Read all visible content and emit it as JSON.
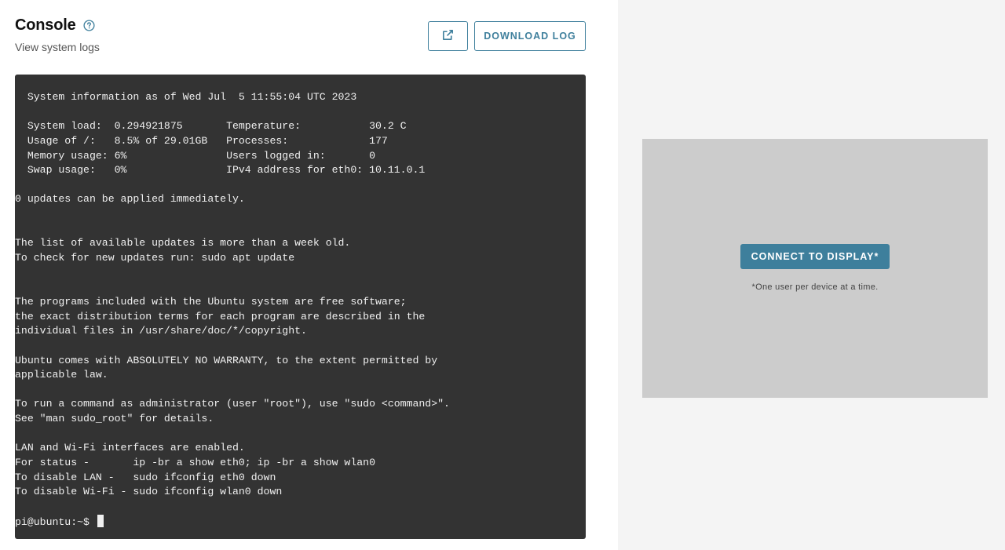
{
  "header": {
    "title": "Console",
    "subtitle": "View system logs",
    "help_icon": "question-circle-icon",
    "external_icon": "external-link-icon",
    "download_label": "DOWNLOAD LOG"
  },
  "colors": {
    "accent": "#3e7f9c",
    "terminal_bg": "#333333",
    "terminal_fg": "#f0f0f0",
    "right_pane_bg": "#f4f4f4",
    "display_bg": "#cccccc"
  },
  "terminal": {
    "lines": [
      "  System information as of Wed Jul  5 11:55:04 UTC 2023",
      "",
      "  System load:  0.294921875       Temperature:           30.2 C",
      "  Usage of /:   8.5% of 29.01GB   Processes:             177",
      "  Memory usage: 6%                Users logged in:       0",
      "  Swap usage:   0%                IPv4 address for eth0: 10.11.0.1",
      "",
      "0 updates can be applied immediately.",
      "",
      "",
      "The list of available updates is more than a week old.",
      "To check for new updates run: sudo apt update",
      "",
      "",
      "The programs included with the Ubuntu system are free software;",
      "the exact distribution terms for each program are described in the",
      "individual files in /usr/share/doc/*/copyright.",
      "",
      "Ubuntu comes with ABSOLUTELY NO WARRANTY, to the extent permitted by",
      "applicable law.",
      "",
      "To run a command as administrator (user \"root\"), use \"sudo <command>\".",
      "See \"man sudo_root\" for details.",
      "",
      "LAN and Wi-Fi interfaces are enabled.",
      "For status -       ip -br a show eth0; ip -br a show wlan0",
      "To disable LAN -   sudo ifconfig eth0 down",
      "To disable Wi-Fi - sudo ifconfig wlan0 down",
      ""
    ],
    "prompt": "pi@ubuntu:~$ "
  },
  "display": {
    "connect_label": "CONNECT TO DISPLAY*",
    "note": "*One user per device at a time."
  }
}
